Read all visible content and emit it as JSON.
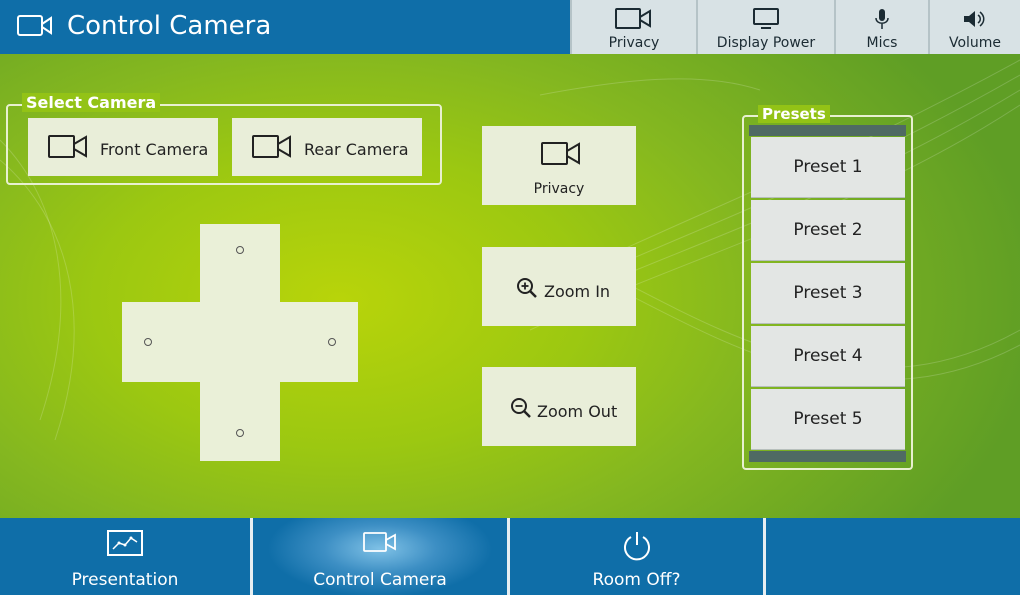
{
  "header": {
    "title": "Control Camera",
    "icon": "video-camera-icon",
    "buttons": [
      {
        "label": "Privacy",
        "icon": "video-camera-icon"
      },
      {
        "label": "Display Power",
        "icon": "monitor-icon"
      },
      {
        "label": "Mics",
        "icon": "microphone-icon"
      },
      {
        "label": "Volume",
        "icon": "speaker-icon"
      }
    ]
  },
  "select_camera": {
    "title": "Select Camera",
    "cameras": [
      {
        "label": "Front Camera",
        "icon": "video-camera-icon"
      },
      {
        "label": "Rear Camera",
        "icon": "video-camera-icon"
      }
    ]
  },
  "dpad": {
    "directions": [
      "up",
      "left",
      "right",
      "down"
    ]
  },
  "actions": {
    "privacy": {
      "label": "Privacy",
      "icon": "video-camera-icon"
    },
    "zoom_in": {
      "label": "Zoom In",
      "icon": "zoom-in-icon"
    },
    "zoom_out": {
      "label": "Zoom Out",
      "icon": "zoom-out-icon"
    }
  },
  "presets": {
    "title": "Presets",
    "items": [
      "Preset 1",
      "Preset 2",
      "Preset 3",
      "Preset 4",
      "Preset 5"
    ]
  },
  "bottom_nav": {
    "tabs": [
      {
        "label": "Presentation",
        "icon": "presentation-icon",
        "active": false
      },
      {
        "label": "Control Camera",
        "icon": "video-camera-icon",
        "active": true
      },
      {
        "label": "Room Off?",
        "icon": "power-icon",
        "active": false
      }
    ]
  },
  "colors": {
    "header_blue": "#0f6ea8",
    "background_green": "#9cc811",
    "button_light": "#e9eed9",
    "preset_gray": "#e3e6e4"
  }
}
